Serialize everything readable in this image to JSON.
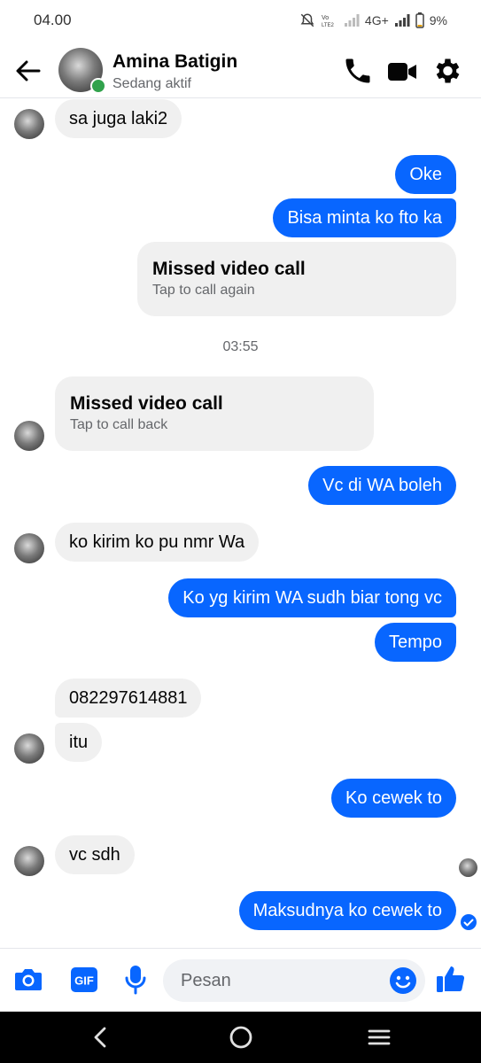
{
  "status_bar": {
    "time": "04.00",
    "network": "4G+",
    "battery": "9%"
  },
  "header": {
    "contact_name": "Amina Batigin",
    "contact_status": "Sedang aktif"
  },
  "messages": {
    "m1": "sa juga laki2",
    "m2": "Oke",
    "m3": "Bisa minta ko fto ka",
    "missed_call_1": {
      "title": "Missed video call",
      "subtitle": "Tap to call again"
    },
    "timestamp": "03:55",
    "missed_call_2": {
      "title": "Missed video call",
      "subtitle": "Tap to call back"
    },
    "m4": "Vc di WA boleh",
    "m5": "ko kirim ko pu nmr Wa",
    "m6": "Ko yg kirim WA sudh biar tong vc",
    "m7": "Tempo",
    "m8": "082297614881",
    "m9": "itu",
    "m10": "Ko cewek to",
    "m11": "vc sdh",
    "m12": "Maksudnya ko cewek to"
  },
  "composer": {
    "placeholder": "Pesan"
  },
  "colors": {
    "outgoing_bubble": "#0866ff",
    "incoming_bubble": "#f0f0f0",
    "accent": "#0866ff",
    "online": "#31a24c"
  }
}
